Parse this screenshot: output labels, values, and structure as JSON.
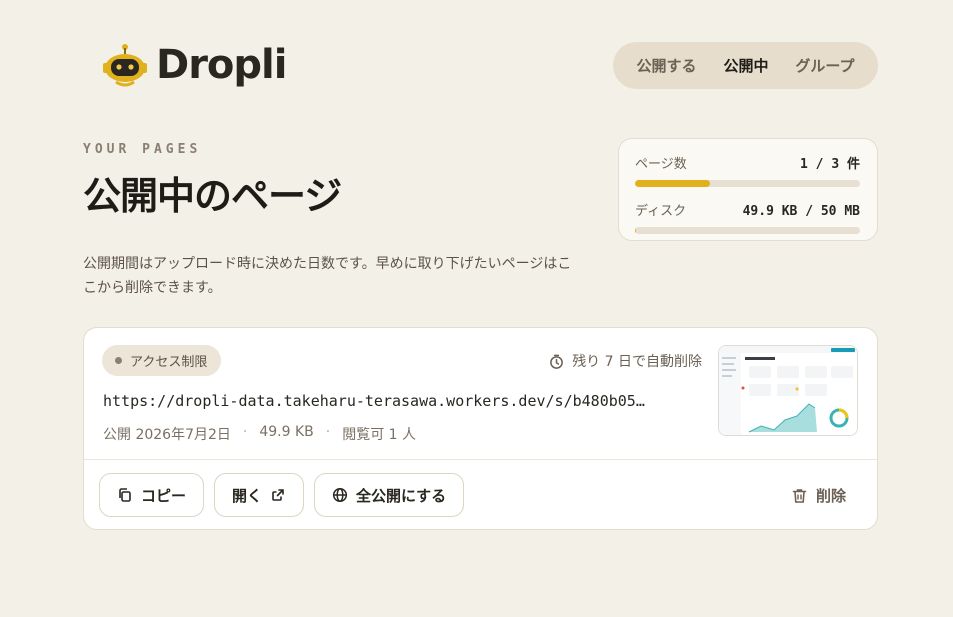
{
  "brand": {
    "name": "Dropli",
    "mascot_icon": "robot-mascot-icon"
  },
  "nav": {
    "items": [
      {
        "label": "公開する",
        "active": false
      },
      {
        "label": "公開中",
        "active": true
      },
      {
        "label": "グループ",
        "active": false
      }
    ]
  },
  "header": {
    "eyebrow": "YOUR PAGES",
    "title": "公開中のページ",
    "description": "公開期間はアップロード時に決めた日数です。早めに取り下げたいページはここから削除できます。"
  },
  "stats": {
    "pages_label": "ページ数",
    "pages_value": "1 / 3 件",
    "pages_fraction": 0.333,
    "disk_label": "ディスク",
    "disk_value": "49.9 KB / 50 MB",
    "disk_fraction": 0.001
  },
  "page_card": {
    "badge": "アクセス制限",
    "remaining": "残り 7 日で自動削除",
    "url": "https://dropli-data.takeharu-terasawa.workers.dev/s/b480b05…",
    "published": "公開 2026年7月2日",
    "size": "49.9 KB",
    "views": "閲覧可 1 人",
    "actions": {
      "copy": "コピー",
      "open": "開く",
      "publish_all": "全公開にする",
      "delete": "削除"
    }
  },
  "colors": {
    "accent": "#e0b11c",
    "background": "#f3f0e8",
    "card": "#ffffff"
  }
}
